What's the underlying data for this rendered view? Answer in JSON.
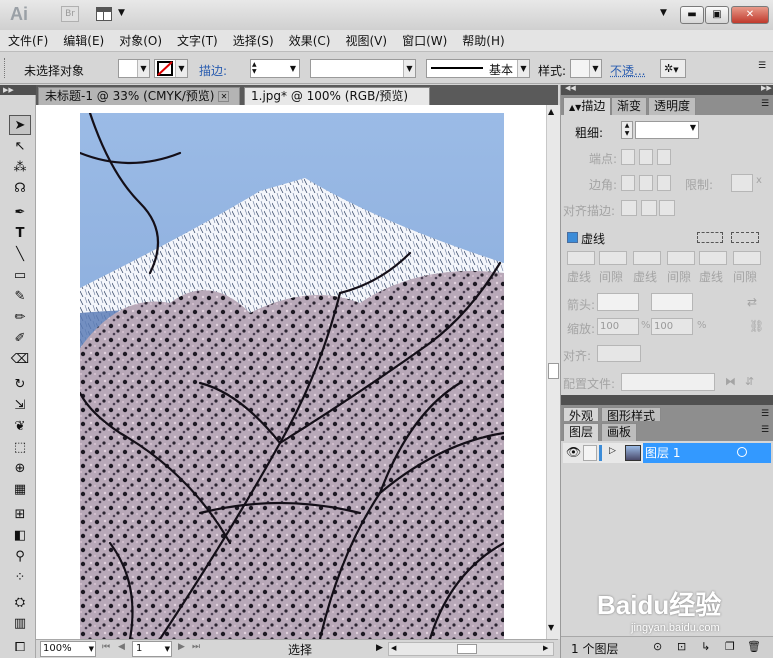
{
  "app": {
    "logo": "Ai",
    "bridge_label": "Br"
  },
  "menus": [
    "文件(F)",
    "编辑(E)",
    "对象(O)",
    "文字(T)",
    "选择(S)",
    "效果(C)",
    "视图(V)",
    "窗口(W)",
    "帮助(H)"
  ],
  "control": {
    "selection_label": "未选择对象",
    "stroke_label": "描边:",
    "stroke_profile": "基本",
    "style_label": "样式:",
    "opacity_label": "不透..."
  },
  "tabs": [
    {
      "label": "未标题-1 @ 33% (CMYK/预览)",
      "close": "✕"
    },
    {
      "label": "1.jpg* @ 100% (RGB/预览)",
      "close": "✕"
    }
  ],
  "status": {
    "zoom": "100%",
    "artboard": "1",
    "mode": "选择"
  },
  "stroke_panel": {
    "tabs": [
      "描边",
      "渐变",
      "透明度"
    ],
    "weight_label": "粗细:",
    "cap_label": "端点:",
    "corner_label": "边角:",
    "limit_label": "限制:",
    "limit_unit": "x",
    "align_label": "对齐描边:",
    "dashed_label": "虚线",
    "dash_labels": [
      "虚线",
      "间隙",
      "虚线",
      "间隙",
      "虚线",
      "间隙"
    ],
    "arrow_label": "箭头:",
    "scale_label": "缩放:",
    "scale_value_1": "100",
    "scale_value_2": "100",
    "percent": "%",
    "arrow_align_label": "对齐:",
    "profile_label": "配置文件:"
  },
  "appearance_panel": {
    "tabs": [
      "外观",
      "图形样式"
    ]
  },
  "layers_panel": {
    "tabs": [
      "图层",
      "画板"
    ],
    "layer_name": "图层 1",
    "count_label": "1 个图层"
  },
  "watermark": {
    "brand": "Baidu经验",
    "url": "jingyan.baidu.com"
  },
  "colors": {
    "accent_blue": "#3c8cd8",
    "layer_selected": "#3399ff",
    "panel_bg": "#d6d6d6",
    "sky": "#8fb0dc"
  }
}
